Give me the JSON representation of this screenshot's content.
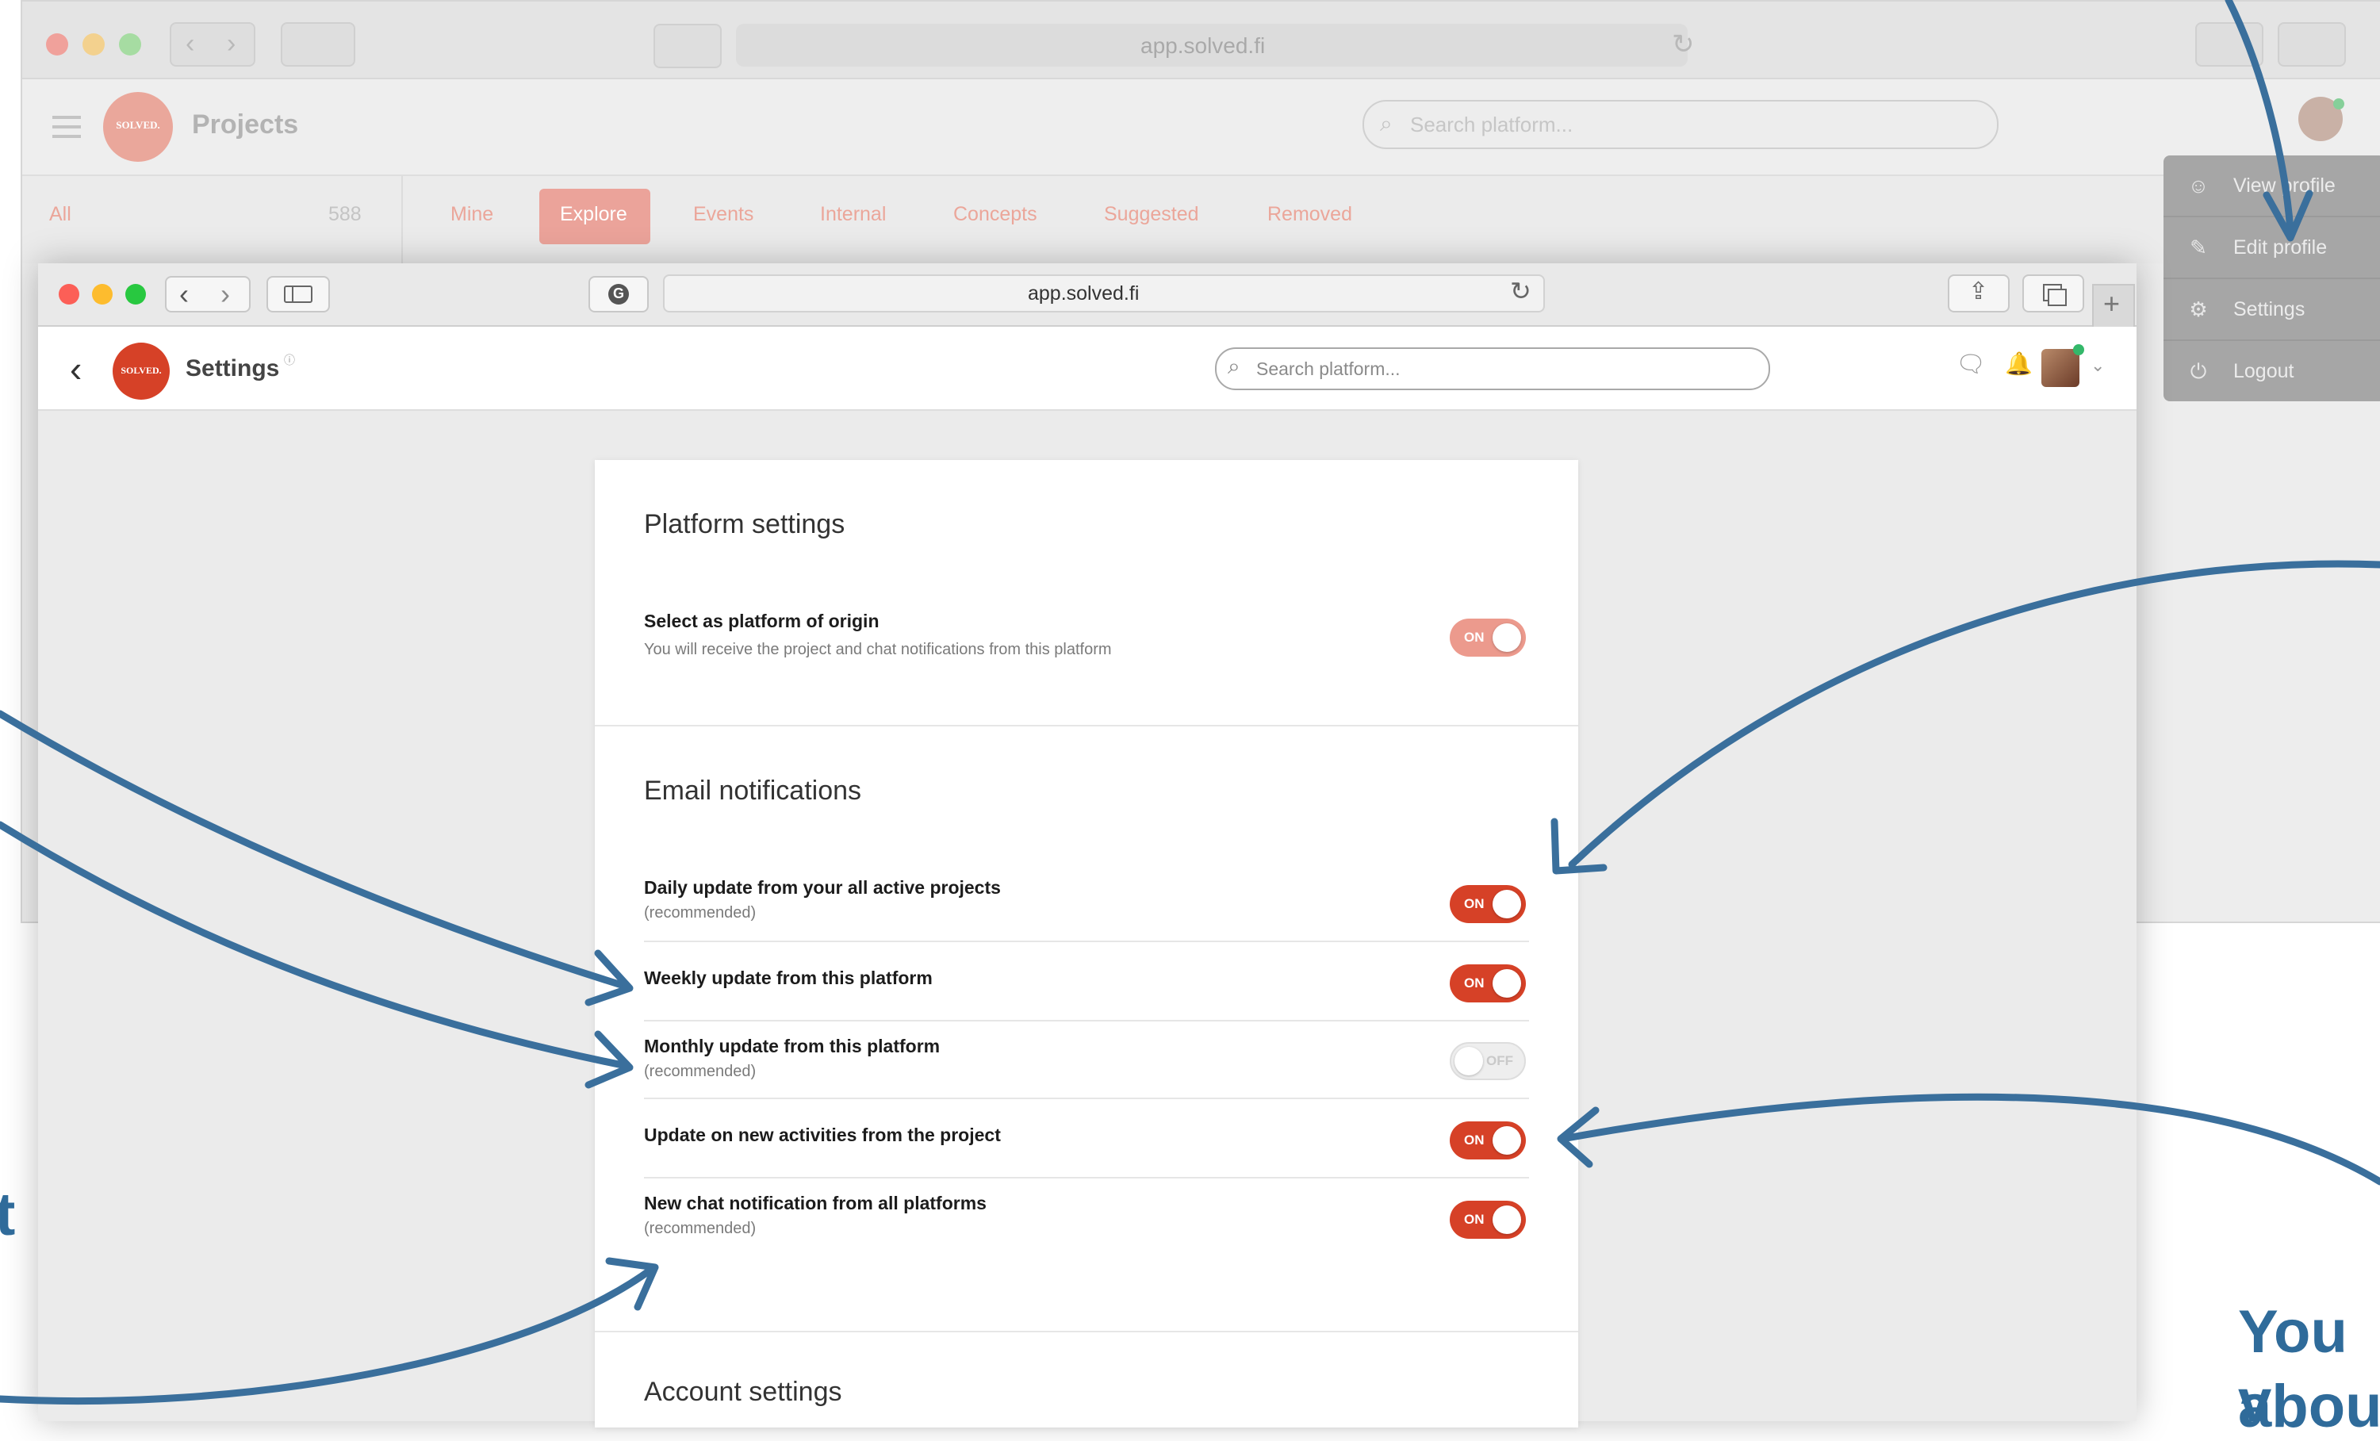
{
  "background_window": {
    "address": "app.solved.fi",
    "logo_text": "SOLVED.",
    "title": "Projects",
    "search_placeholder": "Search platform...",
    "sidebar_all_label": "All",
    "sidebar_all_count": "588",
    "tabs": [
      {
        "label": "Mine"
      },
      {
        "label": "Explore"
      },
      {
        "label": "Events"
      },
      {
        "label": "Internal"
      },
      {
        "label": "Concepts"
      },
      {
        "label": "Suggested"
      },
      {
        "label": "Removed"
      }
    ],
    "menu": [
      {
        "label": "View profile",
        "icon": "user-icon"
      },
      {
        "label": "Edit profile",
        "icon": "pencil-icon"
      },
      {
        "label": "Settings",
        "icon": "gear-icon"
      },
      {
        "label": "Logout",
        "icon": "power-icon"
      }
    ]
  },
  "foreground_window": {
    "address": "app.solved.fi",
    "logo_text": "SOLVED.",
    "title": "Settings",
    "search_placeholder": "Search platform..."
  },
  "settings": {
    "platform": {
      "title": "Platform settings",
      "items": [
        {
          "label": "Select as platform of origin",
          "sub": "You will receive the project and chat notifications from this platform",
          "state": "ON"
        }
      ]
    },
    "email": {
      "title": "Email notifications",
      "items": [
        {
          "label": "Daily update from your all active projects",
          "sub": "(recommended)",
          "state": "ON"
        },
        {
          "label": "Weekly update from this platform",
          "sub": "",
          "state": "ON"
        },
        {
          "label": "Monthly update from this platform",
          "sub": "(recommended)",
          "state": "OFF"
        },
        {
          "label": "Update on new activities from the project",
          "sub": "",
          "state": "ON"
        },
        {
          "label": "New chat notification from all platforms",
          "sub": "(recommended)",
          "state": "ON"
        }
      ]
    },
    "account": {
      "title": "Account settings"
    }
  },
  "annotations": {
    "left_fragment": "t",
    "right_line1": "You v",
    "right_line2": "abou"
  },
  "colors": {
    "brand_red": "#d64127",
    "arrow_blue": "#3a6f9c"
  }
}
